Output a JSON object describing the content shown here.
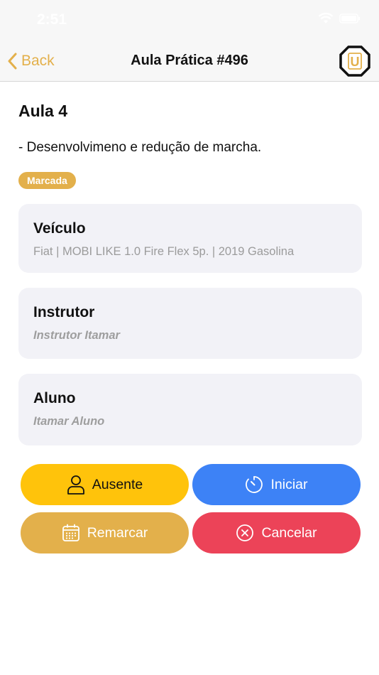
{
  "status_bar": {
    "time": "2:51"
  },
  "nav": {
    "back_label": "Back",
    "title": "Aula Prática #496",
    "logo_letter": "U"
  },
  "lesson": {
    "title": "Aula 4",
    "description": "- Desenvolvimeno e redução de marcha.",
    "status_badge": "Marcada"
  },
  "cards": {
    "vehicle": {
      "title": "Veículo",
      "value": "Fiat | MOBI LIKE 1.0 Fire Flex 5p. | 2019 Gasolina"
    },
    "instructor": {
      "title": "Instrutor",
      "value": "Instrutor Itamar"
    },
    "student": {
      "title": "Aluno",
      "value": "Itamar Aluno"
    }
  },
  "actions": {
    "absent": "Ausente",
    "start": "Iniciar",
    "reschedule": "Remarcar",
    "cancel": "Cancelar"
  },
  "colors": {
    "accent_gold": "#e3b04b",
    "absent_yellow": "#ffc30b",
    "start_blue": "#3d82f6",
    "cancel_red": "#ec4358",
    "card_bg": "#f2f2f7"
  },
  "icons": {
    "back": "chevron-left-icon",
    "logo": "octagon-u-logo",
    "absent": "person-icon",
    "start": "timer-icon",
    "reschedule": "calendar-icon",
    "cancel": "x-circle-icon"
  }
}
